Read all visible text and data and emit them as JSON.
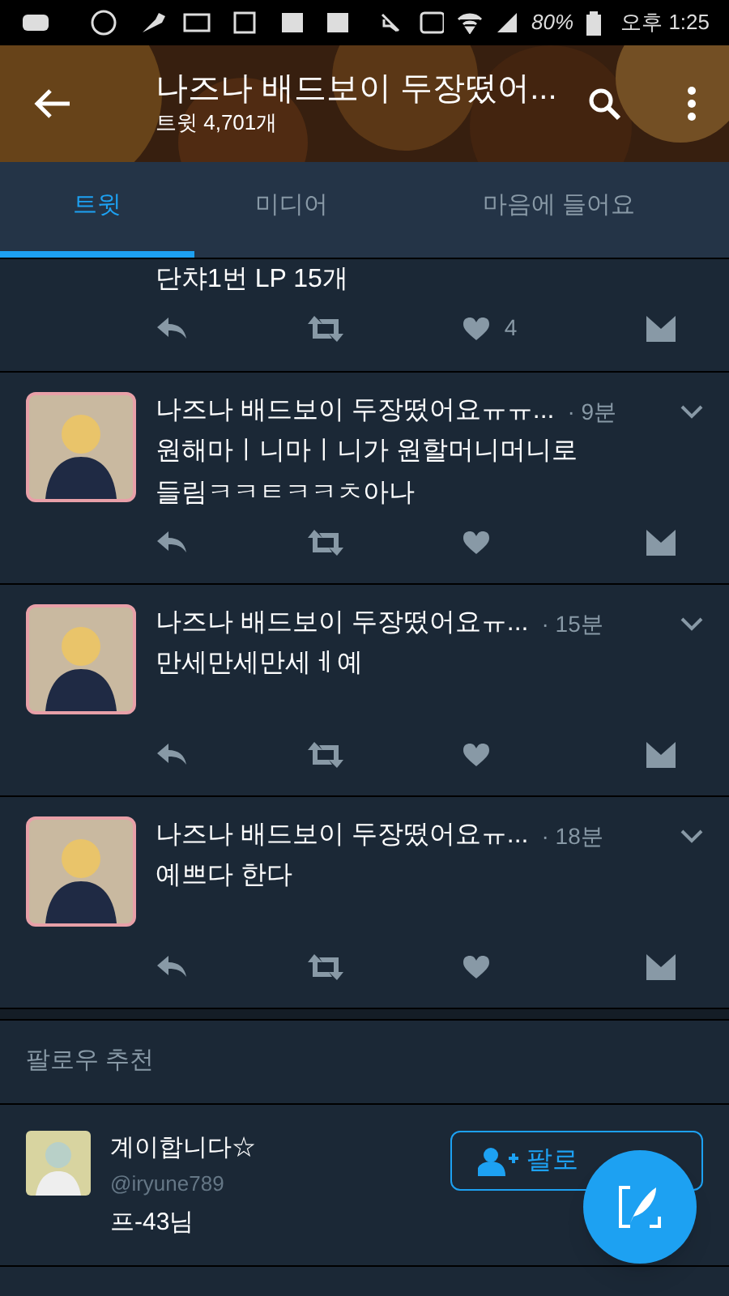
{
  "status_bar": {
    "battery": "80%",
    "time": "오후 1:25"
  },
  "header": {
    "title": "나즈나 배드보이 두장떴어...",
    "subtitle": "트윗 4,701개"
  },
  "tabs": [
    {
      "label": "트윗",
      "selected": true
    },
    {
      "label": "미디어",
      "selected": false
    },
    {
      "label": "마음에 들어요",
      "selected": false
    }
  ],
  "tweets": [
    {
      "kind": "continuation",
      "text": "단챠1번 LP 15개",
      "like_count": "4"
    },
    {
      "kind": "tweet",
      "name": "나즈나 배드보이 두장떴어요ㅠㅠ...",
      "time": "· 9분",
      "text": "원해마ㅣ니마ㅣ니가 원할머니머니로\n들림ㅋㅋㅌㅋㅋㅊ아나"
    },
    {
      "kind": "tweet",
      "name": "나즈나 배드보이 두장떴어요ㅠ...",
      "time": "· 15분",
      "text": "만세만세만세ㅔ예"
    },
    {
      "kind": "tweet",
      "name": "나즈나 배드보이 두장떴어요ㅠ...",
      "time": "· 18분",
      "text": "예쁘다 한다"
    }
  ],
  "follow_suggestions": {
    "title": "팔로우 추천",
    "users": [
      {
        "name": "계이합니다☆",
        "handle": "@iryune789",
        "bio": "프-43님",
        "button": "팔로"
      }
    ]
  }
}
